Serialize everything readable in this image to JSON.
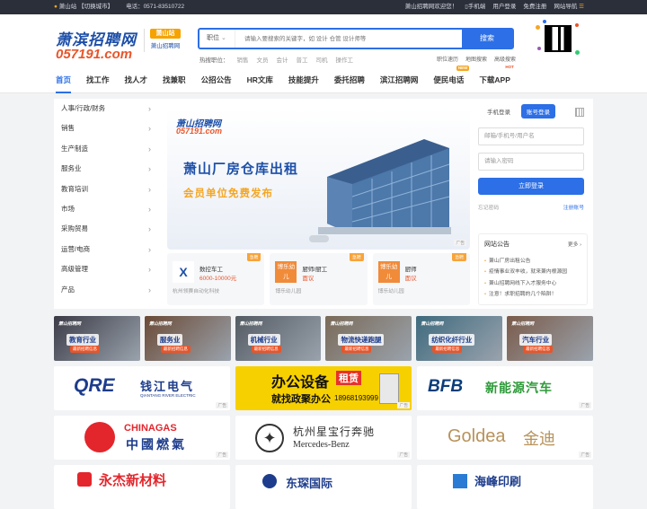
{
  "topbar": {
    "location": "萧山站",
    "switch_city": "【切换城市】",
    "phone": "电话：0571-83510722",
    "welcome": "萧山招聘网欢迎您！",
    "mobile": "手机端",
    "user_login": "用户登录",
    "register": "免费注册",
    "site_nav": "网站导航"
  },
  "logo": {
    "name": "萧滨招聘网",
    "domain": "057191.com",
    "station": "萧山站",
    "station_sub": "萧山招聘网"
  },
  "search": {
    "category": "职位",
    "placeholder": "请输入要搜索的关键字，如 设计 仓管 设计师等",
    "button": "搜索",
    "hot_label": "热搜职位：",
    "hot": [
      "销售",
      "文员",
      "会计",
      "普工",
      "司机",
      "操作工"
    ],
    "tools": [
      "职位速历",
      "地图搜索",
      "高级搜索"
    ]
  },
  "nav": {
    "items": [
      {
        "label": "首页",
        "active": true,
        "badge": ""
      },
      {
        "label": "找工作",
        "active": false,
        "badge": ""
      },
      {
        "label": "找人才",
        "active": false,
        "badge": ""
      },
      {
        "label": "找兼职",
        "active": false,
        "badge": ""
      },
      {
        "label": "公招公告",
        "active": false,
        "badge": ""
      },
      {
        "label": "HR文库",
        "active": false,
        "badge": ""
      },
      {
        "label": "技能提升",
        "active": false,
        "badge": ""
      },
      {
        "label": "委托招聘",
        "active": false,
        "badge": ""
      },
      {
        "label": "滨江招聘网",
        "active": false,
        "badge": ""
      },
      {
        "label": "便民电话",
        "active": false,
        "badge": "NEW"
      },
      {
        "label": "下载APP",
        "active": false,
        "badge": "HOT"
      }
    ]
  },
  "categories": [
    "人事/行政/财务",
    "销售",
    "生产制造",
    "服务业",
    "教育培训",
    "市场",
    "采购贸易",
    "运营/电商",
    "高级管理",
    "产品"
  ],
  "banner": {
    "logo": "萧山招聘网",
    "domain": "057191.com",
    "title": "萧山厂房仓库出租",
    "subtitle": "会员单位免费发布",
    "ad": "广告"
  },
  "jobs": [
    {
      "tag": "急聘",
      "icon": "X",
      "title": "数控车工",
      "salary": "6000-10000元",
      "company": "杭州领赛自动化科技"
    },
    {
      "tag": "急聘",
      "icon": "博乐幼儿",
      "title": "厨师/厨工",
      "salary": "面议",
      "company": "博乐幼儿园"
    },
    {
      "tag": "急聘",
      "icon": "博乐幼儿",
      "title": "厨师",
      "salary": "面议",
      "company": "博乐幼儿园"
    }
  ],
  "login": {
    "tab_mobile": "手机登录",
    "tab_account": "账号登录",
    "username_placeholder": "邮箱/手机号/用户名",
    "password_placeholder": "请输入密码",
    "submit": "立即登录",
    "forgot": "忘记密码",
    "register": "注册账号"
  },
  "notice": {
    "title": "网站公告",
    "more": "更多",
    "items": [
      "萧山厂房出租公告",
      "疫情事业双丰收，就来萧内根源园",
      "萧山招聘网线下入才服务中心",
      "注意！求职招聘的几个陷阱！"
    ]
  },
  "tiles": [
    {
      "name": "教育行业",
      "cta": "最新招聘信息",
      "logo": "萧山招聘网",
      "color": "#3b3b46"
    },
    {
      "name": "服务业",
      "cta": "最新招聘信息",
      "logo": "萧山招聘网",
      "color": "#6b4a36"
    },
    {
      "name": "机械行业",
      "cta": "最新招聘信息",
      "logo": "萧山招聘网",
      "color": "#545b63"
    },
    {
      "name": "物流快递跑腿",
      "cta": "最新招聘信息",
      "logo": "萧山招聘网",
      "color": "#7a6a58"
    },
    {
      "name": "纺织化纤行业",
      "cta": "最新招聘信息",
      "logo": "萧山招聘网",
      "color": "#3e6a7e"
    },
    {
      "name": "汽车行业",
      "cta": "最新招聘信息",
      "logo": "萧山招聘网",
      "color": "#7a5b4a"
    }
  ],
  "brands_row1": [
    {
      "logo": "QRE",
      "cn": "钱江电气",
      "en": "QIANTANG RIVER ELECTRIC",
      "ad": "广告"
    },
    {
      "title": "办公设备",
      "tag": "租赁",
      "line2": "就找政聚办公",
      "phone": "18968193999",
      "ad": "广告"
    },
    {
      "logo": "BFB",
      "cn": "新能源汽车",
      "ad": "广告"
    }
  ],
  "brands_row2": [
    {
      "logo": "CHINAGAS",
      "cn": "中國燃氣",
      "ad": "广告"
    },
    {
      "cn": "杭州星宝行奔驰",
      "en": "Mercedes-Benz",
      "ad": "广告"
    },
    {
      "logo": "Goldea",
      "cn": "金迪",
      "ad": "广告"
    }
  ],
  "brands_row3": [
    {
      "cn": "永杰新材料"
    },
    {
      "cn": "东琛国际"
    },
    {
      "cn": "海峰印刷"
    }
  ],
  "colors": {
    "primary": "#2c6fe6",
    "accent": "#e8552a",
    "gold": "#f5a623"
  }
}
